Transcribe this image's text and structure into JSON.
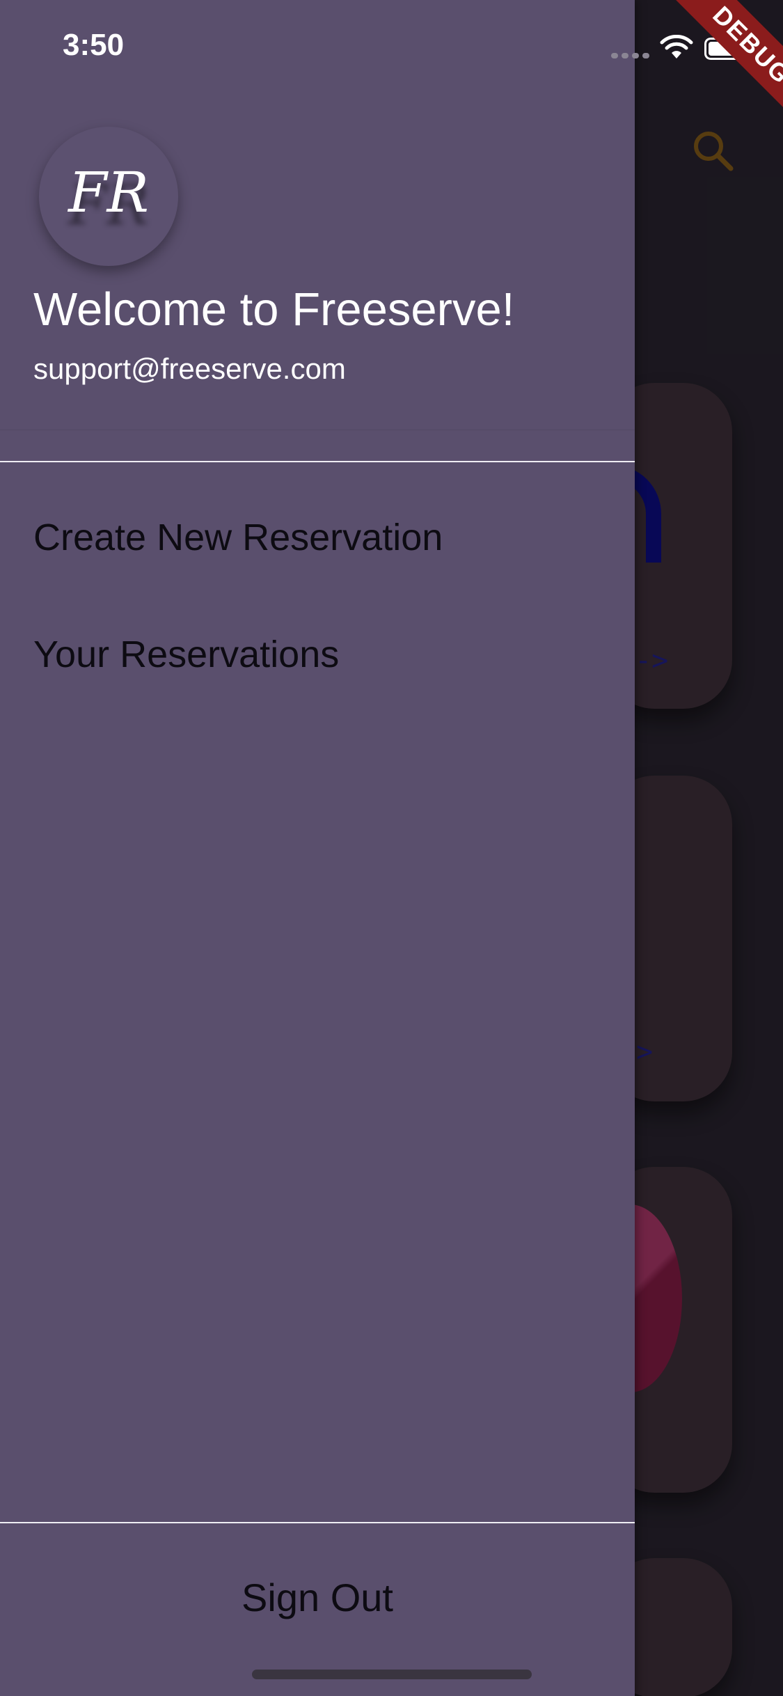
{
  "status_bar": {
    "time": "3:50"
  },
  "debug_banner": {
    "label": "DEBUG"
  },
  "background_app": {
    "search_icon": "search-icon",
    "cards": [
      {
        "arrow": "-->"
      },
      {
        "arrow": ">"
      },
      {
        "arrow": ""
      }
    ]
  },
  "drawer": {
    "avatar_initials": "FR",
    "welcome_title": "Welcome to Freeserve!",
    "email": "support@freeserve.com",
    "menu": [
      {
        "label": "Create New Reservation"
      },
      {
        "label": "Your Reservations"
      }
    ],
    "sign_out_label": "Sign Out"
  },
  "colors": {
    "drawer_background": "#5a4f6d",
    "app_background": "#211d26",
    "card_background": "#33272f",
    "debug_ribbon": "#8b1c1c",
    "search_icon": "#6b4a14"
  }
}
